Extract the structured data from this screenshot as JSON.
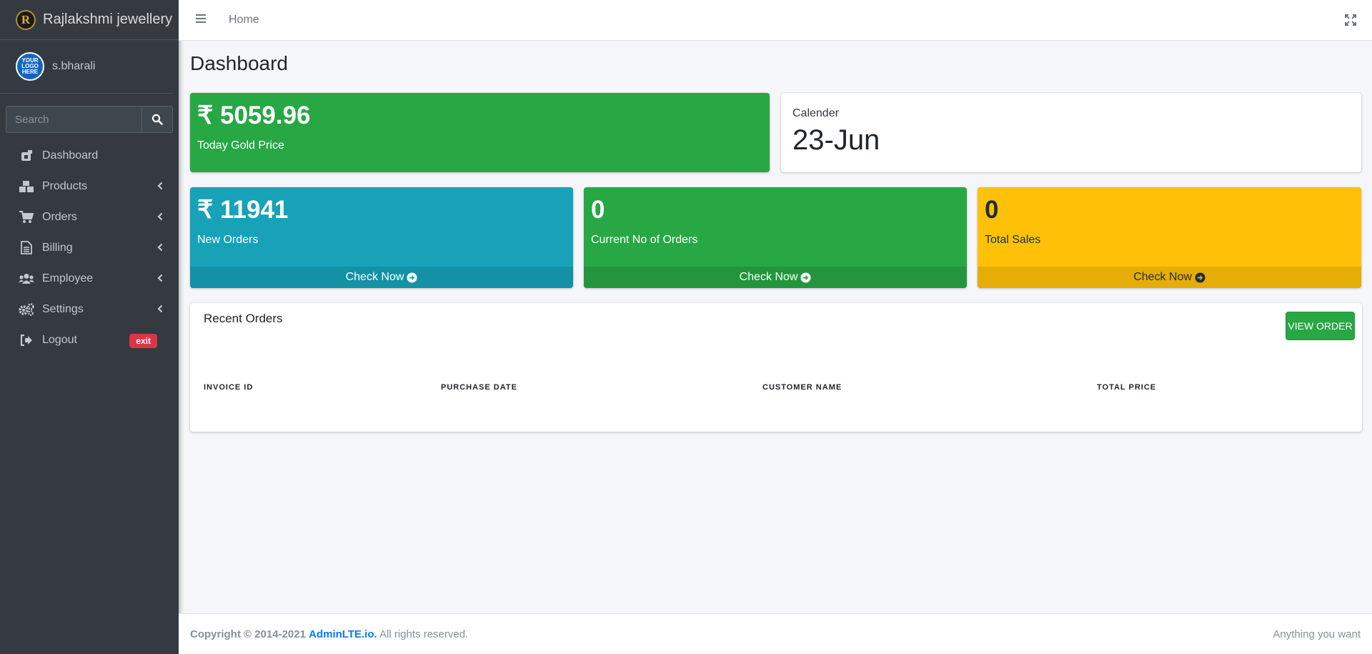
{
  "brand": {
    "name": "Rajlakshmi jewellery",
    "logo_letter": "R"
  },
  "user": {
    "name": "s.bharali",
    "avatar_text": "YOUR LOGO HERE"
  },
  "sidebar": {
    "search_placeholder": "Search",
    "items": [
      {
        "label": "Dashboard",
        "icon": "dashboard-icon"
      },
      {
        "label": "Products",
        "icon": "boxes-icon"
      },
      {
        "label": "Orders",
        "icon": "cart-icon"
      },
      {
        "label": "Billing",
        "icon": "file-icon"
      },
      {
        "label": "Employee",
        "icon": "users-icon"
      },
      {
        "label": "Settings",
        "icon": "gears-icon"
      },
      {
        "label": "Logout",
        "icon": "sign-out-icon",
        "badge": "exit"
      }
    ]
  },
  "topbar": {
    "home_label": "Home"
  },
  "page": {
    "title": "Dashboard"
  },
  "stats": {
    "gold": {
      "value": "₹ 5059.96",
      "label": "Today Gold Price"
    },
    "calendar": {
      "label": "Calender",
      "value": "23-Jun"
    },
    "new_orders": {
      "value": "₹ 11941",
      "label": "New Orders",
      "footer": "Check Now"
    },
    "current_orders": {
      "value": "0",
      "label": "Current No of Orders",
      "footer": "Check Now"
    },
    "total_sales": {
      "value": "0",
      "label": "Total Sales",
      "footer": "Check Now"
    }
  },
  "recent_orders": {
    "title": "Recent Orders",
    "button": "VIEW ORDER",
    "columns": [
      "INVOICE ID",
      "PURCHASE DATE",
      "CUSTOMER NAME",
      "TOTAL PRICE"
    ]
  },
  "footer": {
    "copyright_prefix": "Copyright © 2014-2021",
    "link": "AdminLTE.io.",
    "suffix": "All rights reserved.",
    "right": "Anything you want"
  },
  "colors": {
    "green": "#28a745",
    "cyan": "#17a2b8",
    "yellow": "#ffc107",
    "sidebar": "#343a40",
    "danger": "#dc3545"
  }
}
